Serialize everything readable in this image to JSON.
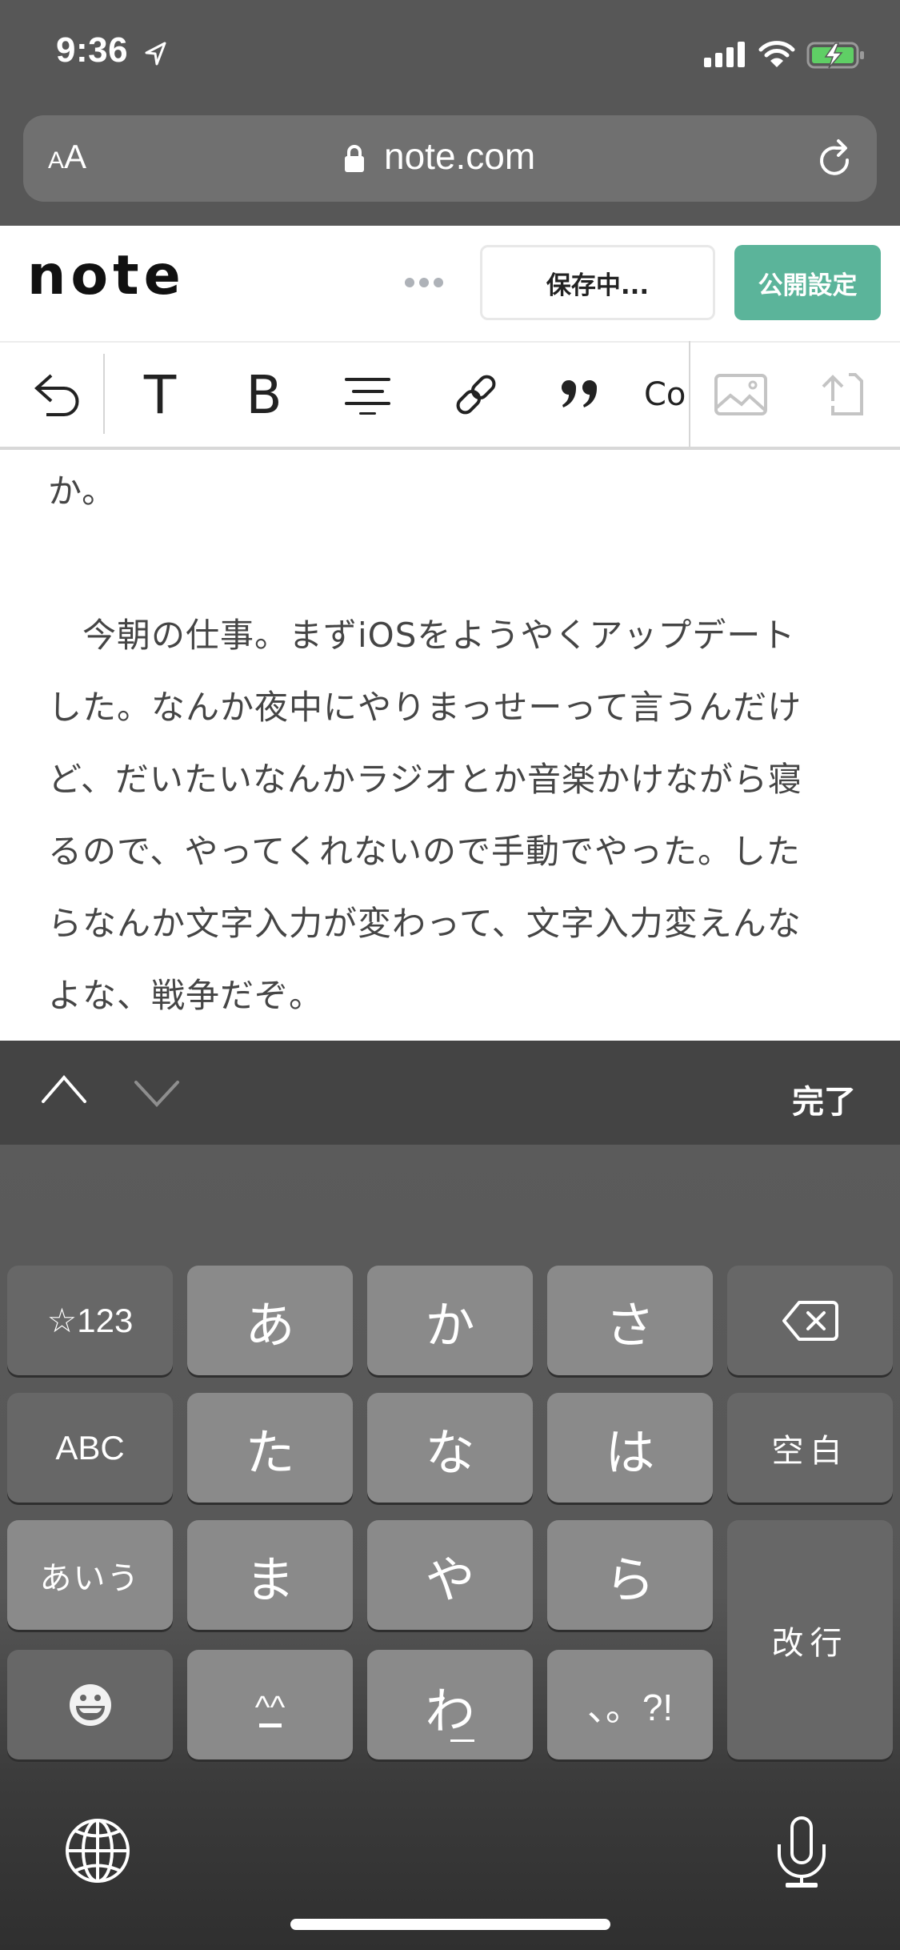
{
  "status_bar": {
    "time": "9:36",
    "location_icon": "location-arrow-icon",
    "signal_icon": "cellular-signal-icon",
    "wifi_icon": "wifi-icon",
    "battery_icon": "battery-charging-icon",
    "battery_color": "#5fcf65"
  },
  "browser": {
    "text_size_button": {
      "small": "A",
      "big": "A"
    },
    "url": "note.com",
    "lock_icon": "lock-icon",
    "reload_icon": "reload-icon"
  },
  "note_header": {
    "logo": "note",
    "more_icon": "more-dots-icon",
    "save_status": "保存中...",
    "publish_button": "公開設定",
    "accent_color": "#5bb49a"
  },
  "toolbar": {
    "undo_icon": "undo-icon",
    "heading_label": "T",
    "bold_label": "B",
    "align_icon": "align-center-icon",
    "link_icon": "link-icon",
    "quote_label": "99",
    "code_label": "Co",
    "image_icon": "image-icon",
    "upload_icon": "file-upload-icon"
  },
  "content": {
    "lines": [
      "か。",
      "　今朝の仕事。まずiOSをようやくアップデート",
      "した。なんか夜中にやりまっせーって言うんだけ",
      "ど、だいたいなんかラジオとか音楽かけながら寝",
      "るので、やってくれないので手動でやった。した",
      "らなんか文字入力が変わって、文字入力変えんな",
      "よな、戦争だぞ。"
    ]
  },
  "accessory_bar": {
    "prev_icon": "chevron-up-icon",
    "next_icon": "chevron-down-icon",
    "done_label": "完了"
  },
  "keyboard": {
    "rows": [
      [
        "☆123",
        "あ",
        "か",
        "さ",
        "backspace"
      ],
      [
        "ABC",
        "た",
        "な",
        "は",
        "空白"
      ],
      [
        "あいう",
        "ま",
        "や",
        "ら",
        "改行"
      ],
      [
        "emoji",
        "^_^",
        "わ_",
        "、。?!"
      ]
    ],
    "keys": {
      "symbols": "☆123",
      "a": "あ",
      "ka": "か",
      "sa": "さ",
      "abc": "ABC",
      "ta": "た",
      "na": "な",
      "ha": "は",
      "space": "空白",
      "aiu": "あいう",
      "ma": "ま",
      "ya": "や",
      "ra": "ら",
      "return": "改行",
      "kaomoji": "^^",
      "wa": "わ",
      "punct": "、。?!"
    },
    "globe_icon": "globe-icon",
    "mic_icon": "microphone-icon"
  }
}
